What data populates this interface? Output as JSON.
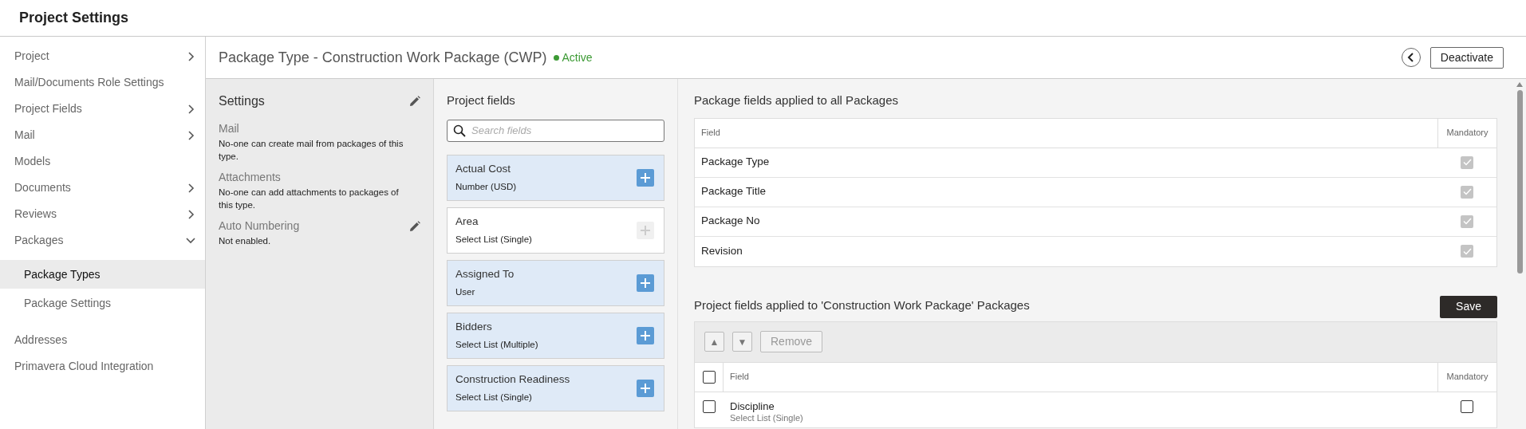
{
  "app_title": "Project Settings",
  "sidebar": {
    "items": [
      {
        "label": "Project",
        "kind": "group",
        "expanded": false,
        "selected": false
      },
      {
        "label": "Mail/Documents Role Settings",
        "kind": "link",
        "selected": false
      },
      {
        "label": "Project Fields",
        "kind": "group",
        "expanded": false,
        "selected": false
      },
      {
        "label": "Mail",
        "kind": "group",
        "expanded": false,
        "selected": false
      },
      {
        "label": "Models",
        "kind": "link",
        "selected": false
      },
      {
        "label": "Documents",
        "kind": "group",
        "expanded": false,
        "selected": false
      },
      {
        "label": "Reviews",
        "kind": "group",
        "expanded": false,
        "selected": false
      },
      {
        "label": "Packages",
        "kind": "group",
        "expanded": true,
        "selected": false,
        "children": [
          {
            "label": "Package Types",
            "selected": true
          },
          {
            "label": "Package Settings",
            "selected": false
          }
        ]
      },
      {
        "label": "Addresses",
        "kind": "link",
        "selected": false
      },
      {
        "label": "Primavera Cloud Integration",
        "kind": "link",
        "selected": false
      }
    ]
  },
  "page_header": {
    "title": "Package Type - Construction Work Package (CWP)",
    "status": "Active",
    "deactivate_button": "Deactivate"
  },
  "settings": {
    "title": "Settings",
    "sections": [
      {
        "label": "Mail",
        "text": "No-one can create mail from packages of this type.",
        "editable": false
      },
      {
        "label": "Attachments",
        "text": "No-one can add attachments to packages of this type.",
        "editable": false
      },
      {
        "label": "Auto Numbering",
        "text": "Not enabled.",
        "editable": true
      }
    ]
  },
  "project_fields": {
    "title": "Project fields",
    "search": {
      "placeholder": "Search fields"
    },
    "fields": [
      {
        "name": "Actual Cost",
        "type": "Number (USD)",
        "disabled": false
      },
      {
        "name": "Area",
        "type": "Select List (Single)",
        "disabled": true
      },
      {
        "name": "Assigned To",
        "type": "User",
        "disabled": false
      },
      {
        "name": "Bidders",
        "type": "Select List (Multiple)",
        "disabled": false
      },
      {
        "name": "Construction Readiness",
        "type": "Select List (Single)",
        "disabled": false
      }
    ]
  },
  "all_packages_table": {
    "title": "Package fields applied to all Packages",
    "columns": [
      "Field",
      "Mandatory"
    ],
    "rows": [
      {
        "field": "Package Type",
        "mandatory": true
      },
      {
        "field": "Package Title",
        "mandatory": true
      },
      {
        "field": "Package No",
        "mandatory": true
      },
      {
        "field": "Revision",
        "mandatory": true
      }
    ]
  },
  "type_table": {
    "title": "Project fields applied to 'Construction Work Package' Packages",
    "save_button": "Save",
    "toolbar": {
      "move_up": "▲",
      "move_down": "▼",
      "remove": "Remove",
      "remove_disabled": true
    },
    "select_all": false,
    "columns": [
      "Field",
      "Mandatory"
    ],
    "rows": [
      {
        "field": "Discipline",
        "type": "Select List (Single)",
        "selected": false,
        "mandatory": false
      }
    ]
  }
}
